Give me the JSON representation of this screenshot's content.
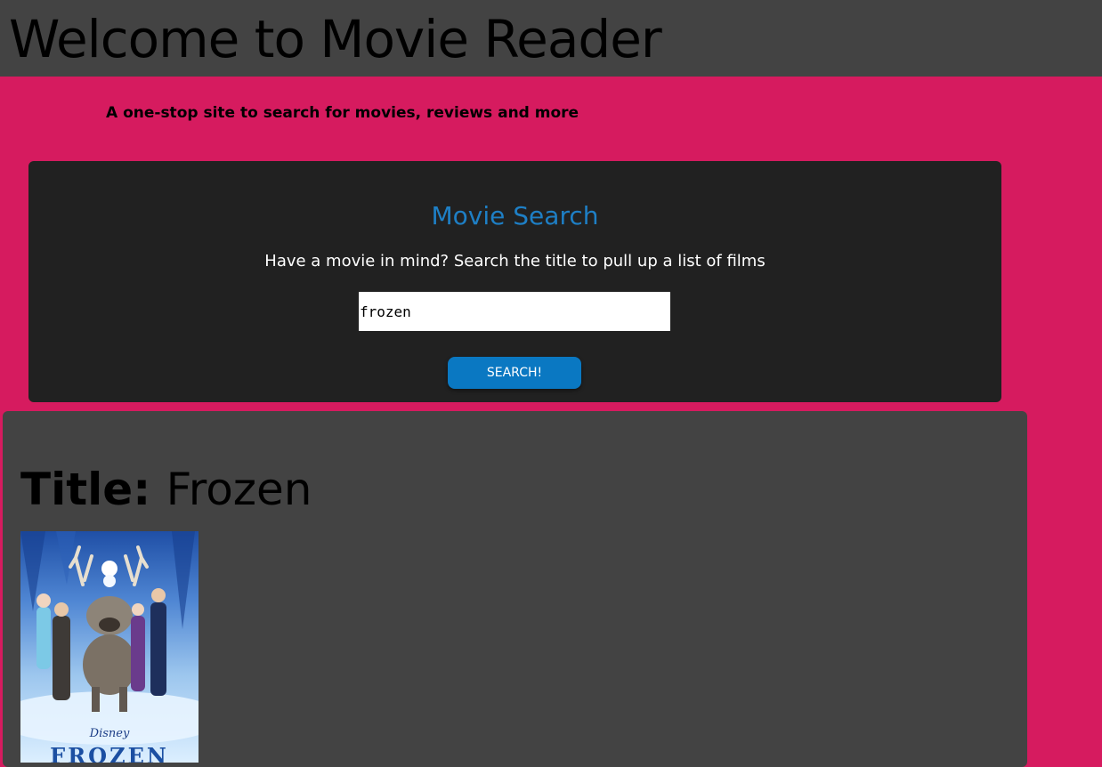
{
  "header": {
    "title": "Welcome to Movie Reader"
  },
  "tagline": "A one-stop site to search for movies, reviews and more",
  "search": {
    "heading": "Movie Search",
    "description": "Have a movie in mind? Search the title to pull up a list of films",
    "input_value": "frozen",
    "button_label": "SEARCH!"
  },
  "result": {
    "title_label": "Title:",
    "title_value": "Frozen",
    "poster": {
      "studio_text": "Disney",
      "movie_text": "FROZEN"
    }
  },
  "colors": {
    "page_background": "#d61b5f",
    "header_background": "#434343",
    "search_card_background": "#212121",
    "accent_blue": "#1e7fc5",
    "button_blue": "#0a78c2",
    "result_card_background": "#434343"
  }
}
